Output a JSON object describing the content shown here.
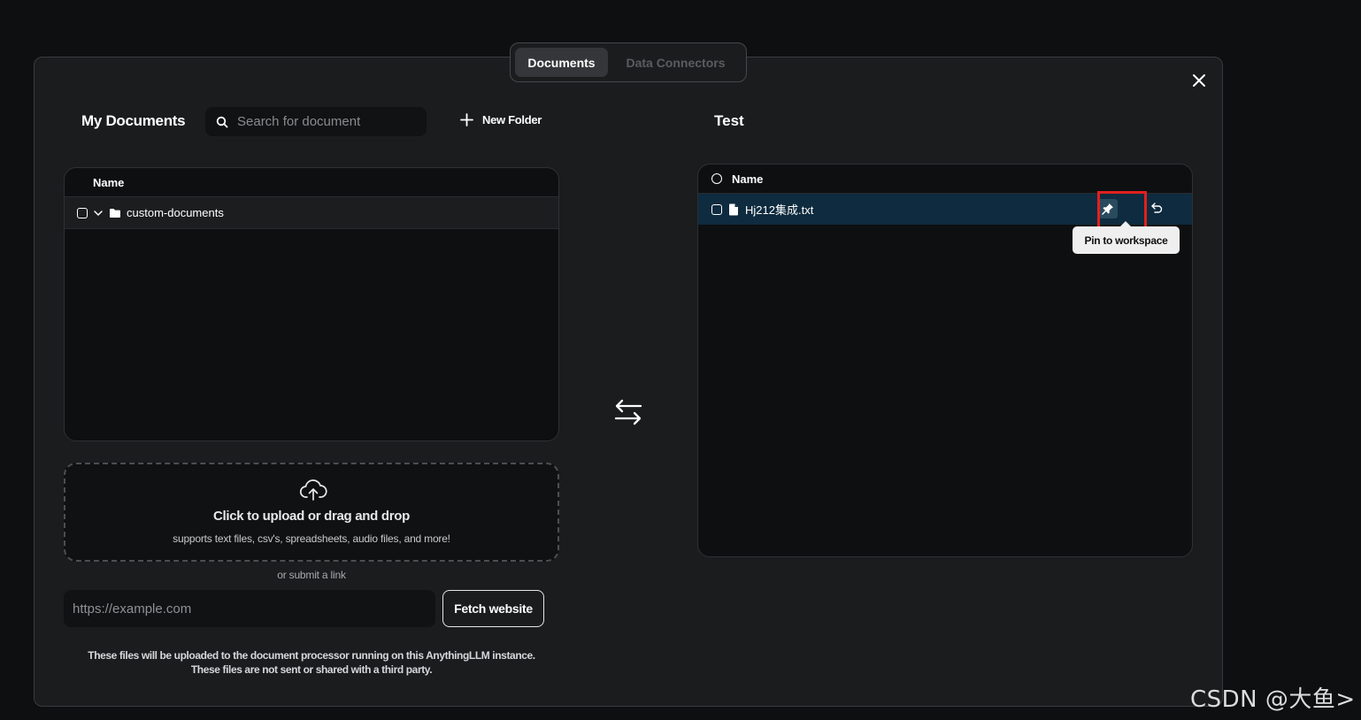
{
  "tabs": [
    {
      "label": "Documents",
      "active": true
    },
    {
      "label": "Data Connectors",
      "active": false
    }
  ],
  "my_documents": {
    "title": "My Documents",
    "search_placeholder": "Search for document",
    "new_folder_label": "New Folder",
    "column_name": "Name",
    "folders": [
      {
        "name": "custom-documents"
      }
    ]
  },
  "upload": {
    "title": "Click to upload or drag and drop",
    "subtitle": "supports text files, csv's, spreadsheets, audio files, and more!",
    "or_link": "or submit a link",
    "url_placeholder": "https://example.com",
    "fetch_label": "Fetch website",
    "notice_line1": "These files will be uploaded to the document processor running on this AnythingLLM instance.",
    "notice_line2": "These files are not sent or shared with a third party."
  },
  "workspace": {
    "title": "Test",
    "column_name": "Name",
    "files": [
      {
        "name": "Hj212集成.txt"
      }
    ],
    "pin_tooltip": "Pin to workspace"
  },
  "watermark": "CSDN @大鱼>",
  "colors": {
    "background": "#0e0f10",
    "modal": "#1b1c1e",
    "selected_row": "#0e2b3f",
    "highlight": "#e0201e",
    "tooltip": "#efefef"
  },
  "icons": [
    "search-icon",
    "plus-icon",
    "close-icon",
    "chevron-down-icon",
    "folder-icon",
    "cloud-upload-icon",
    "swap-arrows-icon",
    "file-icon",
    "pin-icon",
    "undo-icon"
  ]
}
